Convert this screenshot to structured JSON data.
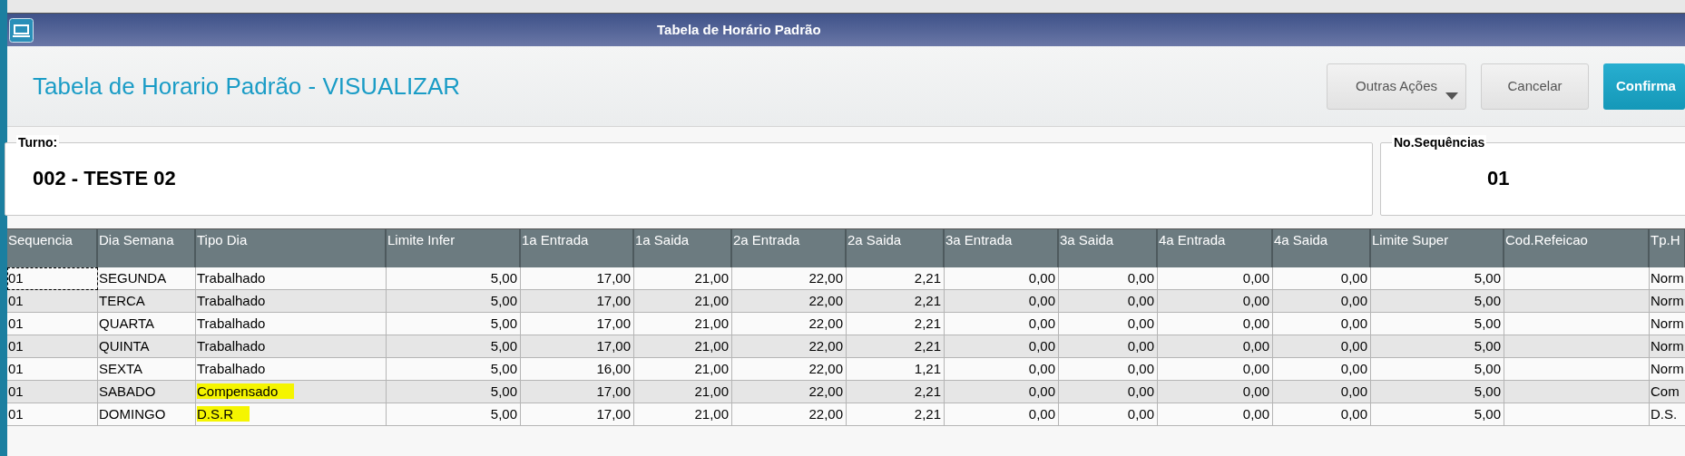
{
  "window": {
    "title": "Tabela de Horário Padrão"
  },
  "heading": "Tabela de Horario Padrão - VISUALIZAR",
  "buttons": [
    {
      "label": "Outras Ações",
      "kind": "dropdown"
    },
    {
      "label": "Cancelar",
      "kind": "plain"
    },
    {
      "label": "Confirma",
      "kind": "primary"
    }
  ],
  "fields": [
    {
      "label": "Turno:",
      "value": "002 - TESTE 02"
    },
    {
      "label": "No.Sequências",
      "value": "01"
    }
  ],
  "table": {
    "columns": [
      "Sequencia",
      "Dia Semana",
      "Tipo Dia",
      "Limite Infer",
      "1a Entrada",
      "1a Saida",
      "2a Entrada",
      "2a Saida",
      "3a Entrada",
      "3a Saida",
      "4a Entrada",
      "4a Saida",
      "Limite Super",
      "Cod.Refeicao",
      "Tp.H"
    ],
    "rows": [
      {
        "selected": true,
        "highlighted": false,
        "cells": [
          "01",
          "SEGUNDA",
          "Trabalhado",
          "5,00",
          "17,00",
          "21,00",
          "22,00",
          "2,21",
          "0,00",
          "0,00",
          "0,00",
          "0,00",
          "5,00",
          "",
          "Norm"
        ]
      },
      {
        "selected": false,
        "highlighted": false,
        "cells": [
          "01",
          "TERCA",
          "Trabalhado",
          "5,00",
          "17,00",
          "21,00",
          "22,00",
          "2,21",
          "0,00",
          "0,00",
          "0,00",
          "0,00",
          "5,00",
          "",
          "Norm"
        ]
      },
      {
        "selected": false,
        "highlighted": false,
        "cells": [
          "01",
          "QUARTA",
          "Trabalhado",
          "5,00",
          "17,00",
          "21,00",
          "22,00",
          "2,21",
          "0,00",
          "0,00",
          "0,00",
          "0,00",
          "5,00",
          "",
          "Norm"
        ]
      },
      {
        "selected": false,
        "highlighted": false,
        "cells": [
          "01",
          "QUINTA",
          "Trabalhado",
          "5,00",
          "17,00",
          "21,00",
          "22,00",
          "2,21",
          "0,00",
          "0,00",
          "0,00",
          "0,00",
          "5,00",
          "",
          "Norm"
        ]
      },
      {
        "selected": false,
        "highlighted": false,
        "cells": [
          "01",
          "SEXTA",
          "Trabalhado",
          "5,00",
          "16,00",
          "21,00",
          "22,00",
          "1,21",
          "0,00",
          "0,00",
          "0,00",
          "0,00",
          "5,00",
          "",
          "Norm"
        ]
      },
      {
        "selected": false,
        "highlighted": true,
        "cells": [
          "01",
          "SABADO",
          "Compensado",
          "5,00",
          "17,00",
          "21,00",
          "22,00",
          "2,21",
          "0,00",
          "0,00",
          "0,00",
          "0,00",
          "5,00",
          "",
          "Com"
        ]
      },
      {
        "selected": false,
        "highlighted": true,
        "cells": [
          "01",
          "DOMINGO",
          "D.S.R",
          "5,00",
          "17,00",
          "21,00",
          "22,00",
          "2,21",
          "0,00",
          "0,00",
          "0,00",
          "0,00",
          "5,00",
          "",
          "D.S."
        ]
      }
    ]
  }
}
